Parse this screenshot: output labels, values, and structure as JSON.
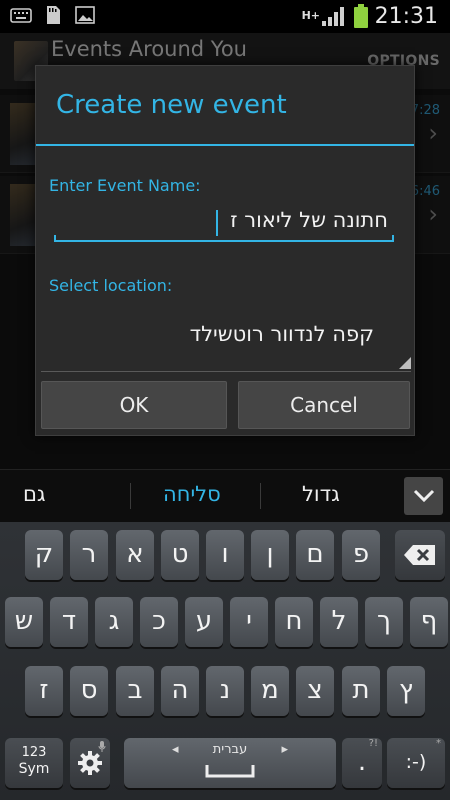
{
  "status_bar": {
    "time": "21:31",
    "network": "H+"
  },
  "app": {
    "title": "Events Around You",
    "options_label": "OPTIONS"
  },
  "list": {
    "items": [
      {
        "time": "7:28"
      },
      {
        "time": "6:46"
      }
    ]
  },
  "dialog": {
    "title": "Create new event",
    "name_label": "Enter Event Name:",
    "name_value": "חתונה של ליאור ז",
    "location_label": "Select location:",
    "location_value": "קפה לנדוור רוטשילד",
    "ok_label": "OK",
    "cancel_label": "Cancel"
  },
  "suggestions": {
    "left": "גם",
    "middle": "סליחה",
    "right": "גדול"
  },
  "keyboard": {
    "row1": [
      "ק",
      "ר",
      "א",
      "ט",
      "ו",
      "ן",
      "ם",
      "פ"
    ],
    "row2": [
      "ש",
      "ד",
      "ג",
      "כ",
      "ע",
      "י",
      "ח",
      "ל",
      "ך",
      "ף"
    ],
    "row3": [
      "ז",
      "ס",
      "ב",
      "ה",
      "נ",
      "מ",
      "צ",
      "ת",
      "ץ"
    ],
    "sym_label_1": "123",
    "sym_label_2": "Sym",
    "space_label": "עברית",
    "period": ".",
    "period_alt": "?!",
    "smiley": ":-)",
    "smiley_alt": "*"
  },
  "colors": {
    "accent": "#33b5e5",
    "battery": "#8fd13f"
  }
}
